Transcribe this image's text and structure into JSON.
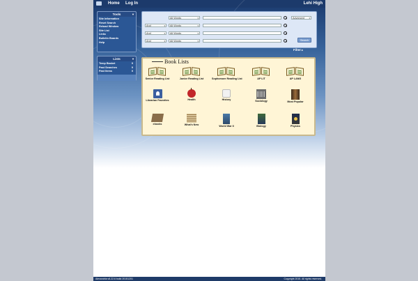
{
  "header": {
    "home": "Home",
    "login": "Log In",
    "school": "Lehi High"
  },
  "tools": {
    "title": "Tools",
    "items": [
      "Site Information",
      "Reset Search",
      "Reload Window",
      "Site List",
      "Links",
      "Bulletin Boards",
      "Help"
    ]
  },
  "lists": {
    "title": "Lists",
    "rows": [
      {
        "label": "Temp Basket",
        "count": "0"
      },
      {
        "label": "Past Searches",
        "count": "0"
      },
      {
        "label": "Past Items",
        "count": "0"
      }
    ]
  },
  "search": {
    "rows": [
      {
        "op": "",
        "field": "All Words",
        "value": ""
      },
      {
        "op": "And",
        "field": "All Words",
        "value": ""
      },
      {
        "op": "And",
        "field": "All Words",
        "value": ""
      },
      {
        "op": "And",
        "field": "All Words",
        "value": ""
      }
    ],
    "mode": "Advanced",
    "button": "Search",
    "filter": "Filter"
  },
  "books": {
    "title": "Book Lists",
    "tiles": [
      {
        "label": "Senior Reading List",
        "icon": "open-book-icon"
      },
      {
        "label": "Junior Reading List",
        "icon": "open-book-icon"
      },
      {
        "label": "Sophomore Reading List",
        "icon": "open-book-icon"
      },
      {
        "label": "AP LIT",
        "icon": "open-book-icon"
      },
      {
        "label": "AP LANG",
        "icon": "open-book-icon"
      },
      {
        "label": "Librarian Favorites",
        "icon": "librarian-icon"
      },
      {
        "label": "Health",
        "icon": "apple-icon"
      },
      {
        "label": "History",
        "icon": "history-icon"
      },
      {
        "label": "Sociology",
        "icon": "sociology-icon"
      },
      {
        "label": "Most Popular",
        "icon": "popular-icon"
      },
      {
        "label": "ebooks",
        "icon": "ebook-icon"
      },
      {
        "label": "What's New",
        "icon": "whats-new-icon"
      },
      {
        "label": "World War II",
        "icon": "ww2-icon"
      },
      {
        "label": "Biology",
        "icon": "biology-icon"
      },
      {
        "label": "Physics",
        "icon": "physics-icon"
      }
    ]
  },
  "footer": {
    "version": "Alexandria v6.22.6 build 20151201",
    "copyright": "Copyright 2015. All rights reserved."
  }
}
